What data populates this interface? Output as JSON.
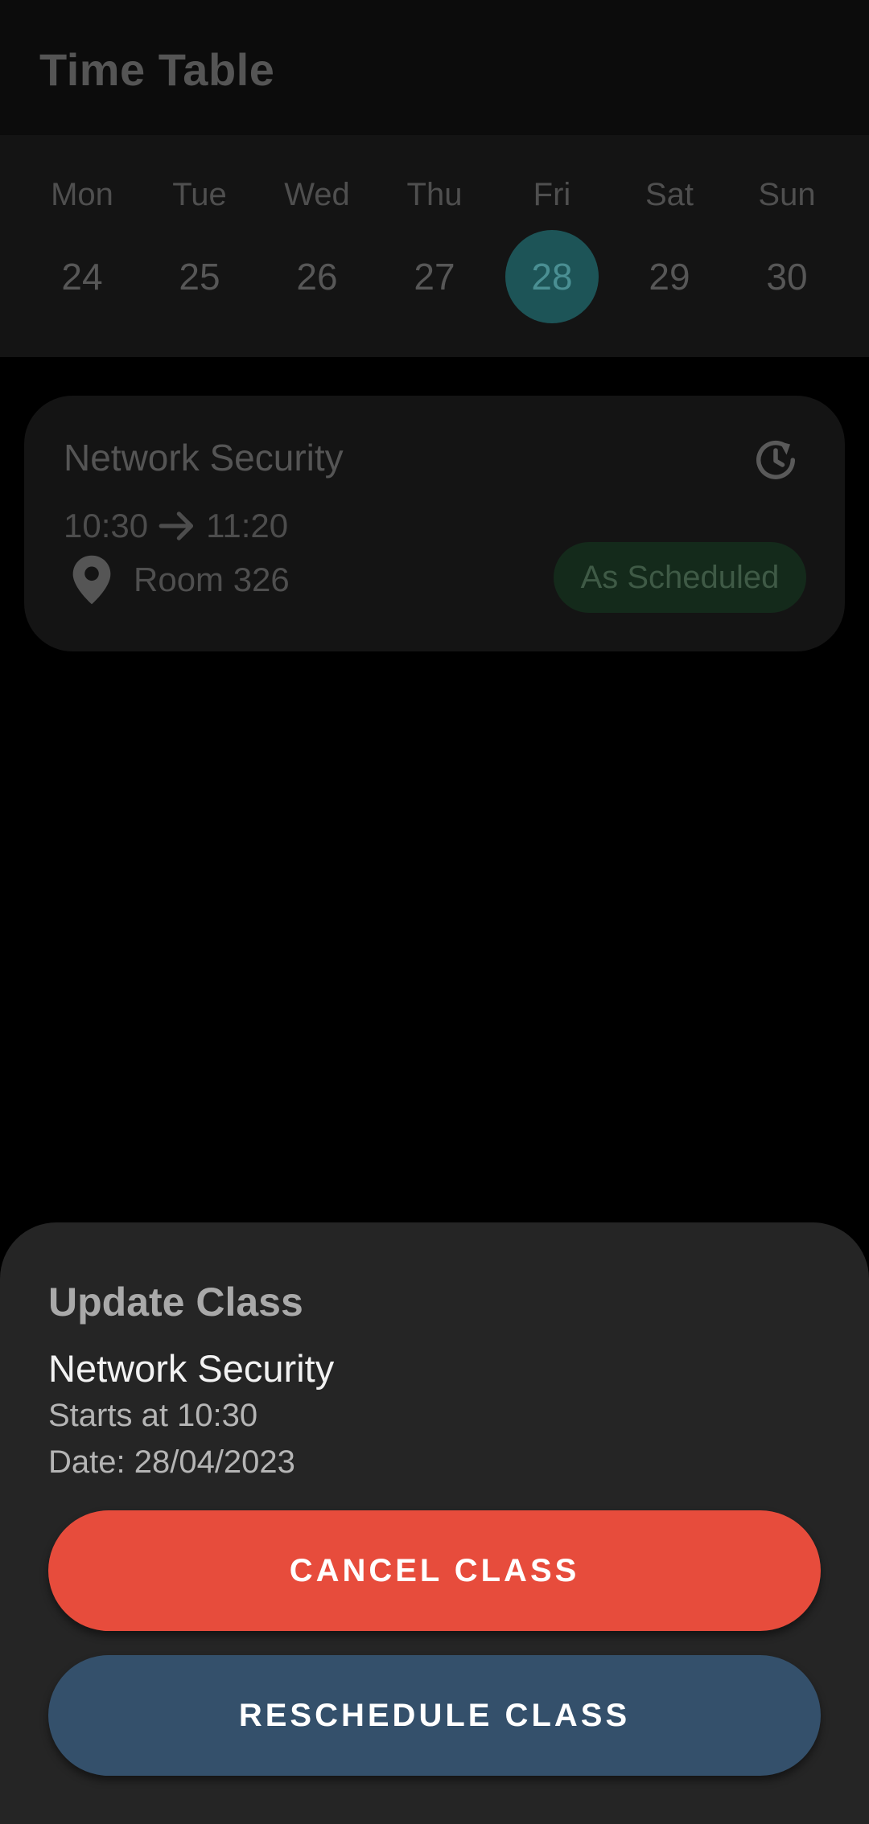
{
  "app_bar": {
    "title": "Time Table"
  },
  "week": {
    "days": [
      {
        "name": "Mon",
        "date": "24",
        "selected": false
      },
      {
        "name": "Tue",
        "date": "25",
        "selected": false
      },
      {
        "name": "Wed",
        "date": "26",
        "selected": false
      },
      {
        "name": "Thu",
        "date": "27",
        "selected": false
      },
      {
        "name": "Fri",
        "date": "28",
        "selected": true
      },
      {
        "name": "Sat",
        "date": "29",
        "selected": false
      },
      {
        "name": "Sun",
        "date": "30",
        "selected": false
      }
    ]
  },
  "class_card": {
    "title": "Network Security",
    "start_time": "10:30",
    "end_time": "11:20",
    "room": "Room 326",
    "status": "As Scheduled",
    "icons": {
      "action": "reschedule-clock-icon",
      "time_arrow": "arrow-right-icon",
      "location": "location-pin-icon"
    }
  },
  "sheet": {
    "heading": "Update Class",
    "class_name": "Network Security",
    "starts_text": "Starts at 10:30",
    "date_text": "Date: 28/04/2023",
    "cancel_label": "CANCEL CLASS",
    "reschedule_label": "RESCHEDULE CLASS"
  },
  "colors": {
    "background": "#000000",
    "selected_day": "#1d5457",
    "status_badge_bg": "#142a1b",
    "cancel_button": "#e74c3c",
    "reschedule_button": "#34506b",
    "sheet_bg": "#252525"
  }
}
